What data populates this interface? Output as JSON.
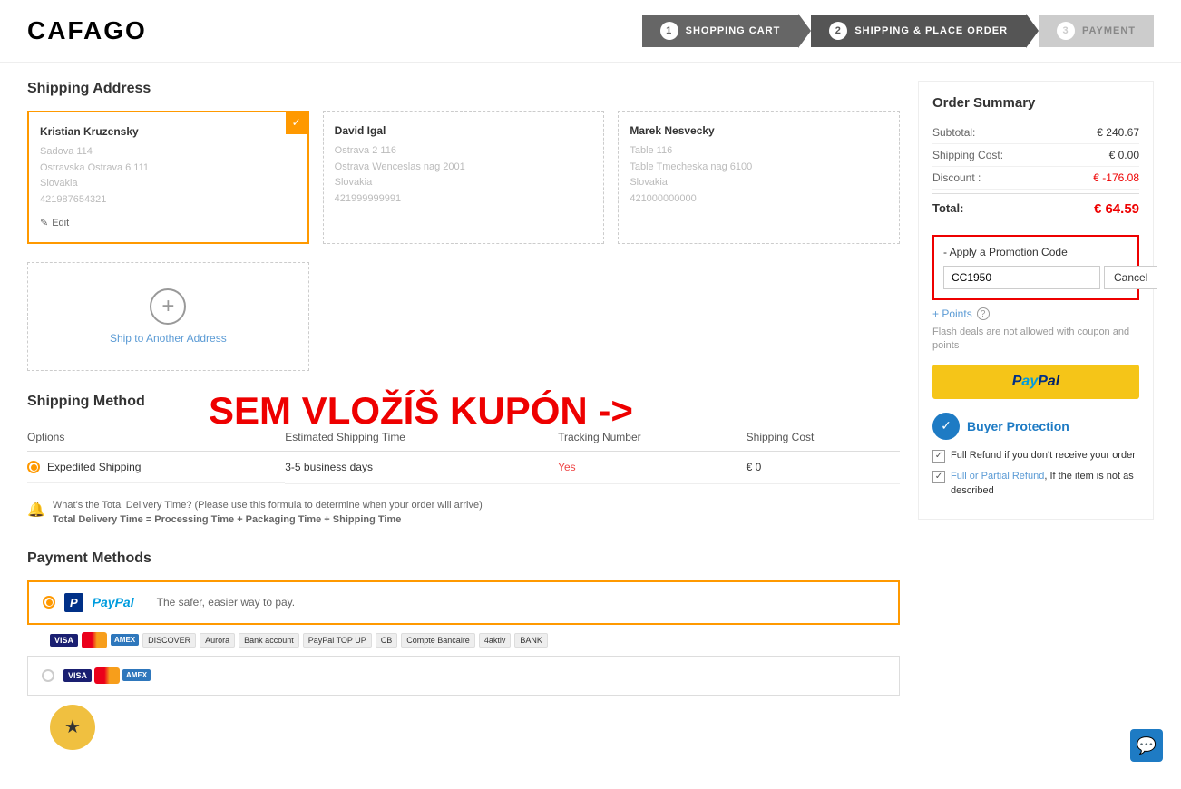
{
  "header": {
    "logo": "CAFAGO",
    "steps": [
      {
        "number": "1",
        "label": "SHOPPING CART",
        "state": "done"
      },
      {
        "number": "2",
        "label": "SHIPPING & PLACE ORDER",
        "state": "active"
      },
      {
        "number": "3",
        "label": "PAYMENT",
        "state": "inactive"
      }
    ]
  },
  "shipping_address": {
    "title": "Shipping Address",
    "addresses": [
      {
        "name": "Kristian Kruzensky",
        "line1": "Sadova 114",
        "line2": "Ostravska Ostrava 6 111",
        "country": "Slovakia",
        "phone": "421987654321",
        "selected": true
      },
      {
        "name": "David Igal",
        "line1": "Ostrava 2 116",
        "line2": "Ostrava Wenceslas nag 2001",
        "country": "Slovakia",
        "phone": "421999999991",
        "selected": false
      },
      {
        "name": "Marek Nesvecky",
        "line1": "Table 116",
        "line2": "Table Tmecheska nag 6100",
        "country": "Slovakia",
        "phone": "421000000000",
        "selected": false
      }
    ],
    "add_label": "Ship to Another Address",
    "edit_label": "Edit"
  },
  "promo_overlay": {
    "text": "SEM VLOŽÍŠ KUPÓN ->"
  },
  "shipping_method": {
    "title": "Shipping Method",
    "columns": [
      "Options",
      "Estimated Shipping Time",
      "Tracking Number",
      "Shipping Cost"
    ],
    "row": {
      "option": "Expedited Shipping",
      "time": "3-5 business days",
      "tracking": "Yes",
      "cost": "€ 0"
    },
    "delivery_note": "What's the Total Delivery Time? (Please use this formula to determine when your order will arrive)",
    "delivery_formula": "Total Delivery Time = Processing Time + Packaging Time + Shipping Time"
  },
  "payment_methods": {
    "title": "Payment Methods",
    "options": [
      {
        "name": "PayPal",
        "desc": "The safer, easier way to pay.",
        "selected": true
      },
      {
        "name": "Visa/MasterCard",
        "selected": false
      }
    ]
  },
  "order_summary": {
    "title": "Order Summary",
    "subtotal_label": "Subtotal:",
    "subtotal_value": "€ 240.67",
    "shipping_label": "Shipping Cost:",
    "shipping_value": "€ 0.00",
    "discount_label": "Discount :",
    "discount_value": "€ -176.08",
    "total_label": "Total:",
    "total_value": "€ 64.59",
    "promo_section": {
      "label": "- Apply a Promotion Code",
      "input_value": "CC1950",
      "cancel_label": "Cancel"
    },
    "points_label": "+ Points",
    "flash_note": "Flash deals are not allowed with coupon and points",
    "paypal_button_label": "PayPal",
    "buyer_protection": {
      "title": "Buyer Protection",
      "items": [
        {
          "text": "Full Refund if you don't receive your order"
        },
        {
          "text1": "Full or Partial Refund",
          "text2": ", If the item is not as described"
        }
      ]
    }
  }
}
